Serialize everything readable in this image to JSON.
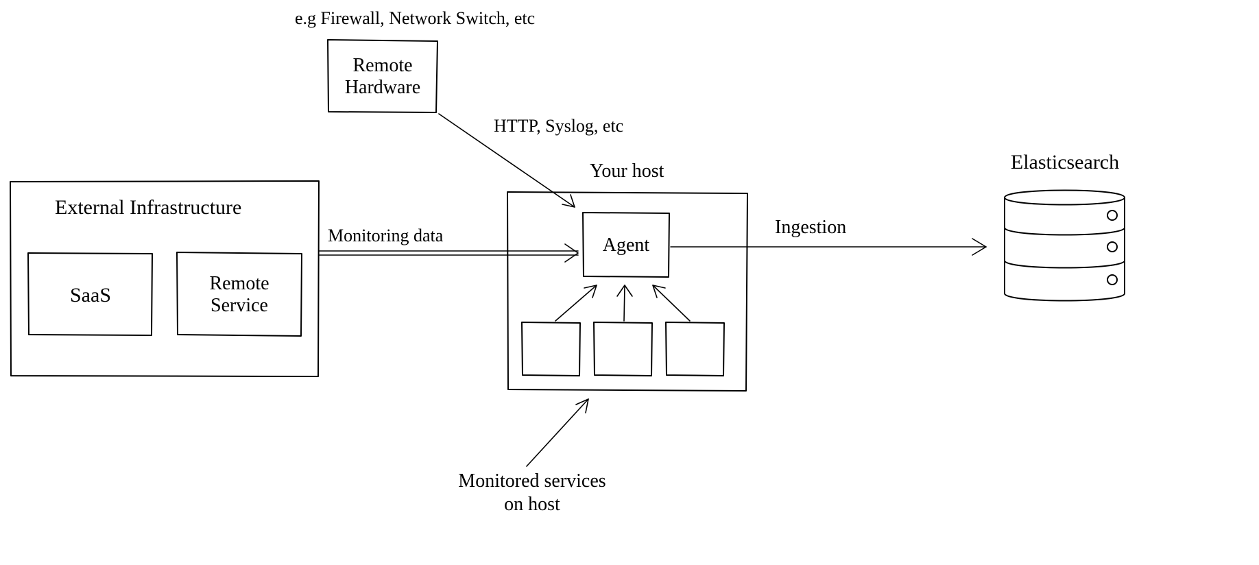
{
  "labels": {
    "remote_hardware_caption": "e.g Firewall, Network Switch, etc",
    "remote_hardware_line1": "Remote",
    "remote_hardware_line2": "Hardware",
    "external_infra_title": "External Infrastructure",
    "saas": "SaaS",
    "remote_service_line1": "Remote",
    "remote_service_line2": "Service",
    "monitoring_data": "Monitoring data",
    "http_syslog": "HTTP, Syslog, etc",
    "your_host": "Your host",
    "agent": "Agent",
    "ingestion": "Ingestion",
    "elasticsearch": "Elasticsearch",
    "monitored_services_line1": "Monitored services",
    "monitored_services_line2": "on host"
  }
}
